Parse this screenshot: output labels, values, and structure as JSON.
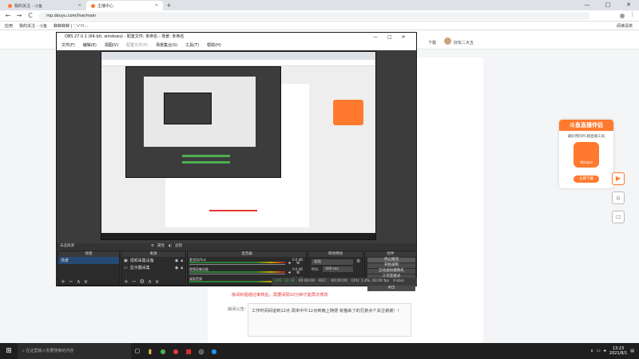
{
  "browser": {
    "tabs": [
      {
        "title": "我的关注 - 斗鱼",
        "active": false
      },
      {
        "title": "主播中心",
        "active": true
      }
    ],
    "new_tab": "+",
    "url": "mp.douyu.com/live/main",
    "bookmarks": [
      "应用",
      "我的关注 - 斗鱼",
      "蝉蝉蝉蝉 | '.'•'ﾂﾂ..."
    ],
    "bookmarks_right": "阅读清单",
    "win_min": "—",
    "win_max": "□",
    "win_close": "✕",
    "nav_back": "←",
    "nav_fwd": "→",
    "nav_reload": "C"
  },
  "page": {
    "header_download": "下载",
    "header_user": "好玩二大五",
    "notice_red": "房间标题通过审核后，需要间隔10分钟才能再次修改",
    "announcement_label": "房间公告：",
    "announcement_text": "工作时间间进到12点 周末中午12点到晚上随便 有猫来了的兄弟点个关注谢谢！！"
  },
  "obs": {
    "title": "OBS 27.0.1 (64-bit, windows) - 配置文件: 未命名 - 场景: 未命名",
    "menu": [
      "文件(F)",
      "编辑(E)",
      "视图(V)",
      "配置文件(P)",
      "场景集合(S)",
      "工具(T)",
      "帮助(H)"
    ],
    "source_bar": {
      "no_source": "未选择源",
      "properties": "属性",
      "filters": "滤镜"
    },
    "scenes": {
      "header": "场景",
      "items": [
        "场景"
      ]
    },
    "sources": {
      "header": "来源",
      "items": [
        "视频采集设备",
        "显示器采集"
      ]
    },
    "mixer": {
      "header": "混音器",
      "channels": [
        {
          "name": "麦克风/Aux",
          "db": "0.0 dB"
        },
        {
          "name": "视频采集设备",
          "db": "0.0 dB"
        },
        {
          "name": "桌面音频",
          "db": "0.0 dB"
        }
      ]
    },
    "transitions": {
      "header": "转场特效",
      "type": "淡化",
      "duration_label": "时长",
      "duration": "300 ms"
    },
    "controls": {
      "header": "控件",
      "buttons": [
        "停止推流",
        "开始录制",
        "启动虚拟摄像机",
        "工作室模式",
        "设置",
        "退出"
      ]
    },
    "status": {
      "live": "LIVE: 12:38",
      "live_time": "00:00:00",
      "rec_label": "REC:",
      "rec_time": "00:00:00",
      "cpu": "CPU: 1.4%, 60.00 fps",
      "kbps": "0 kb/s"
    }
  },
  "ad": {
    "brand": "斗鱼直播伴侣",
    "subtitle": "最好用的PC端直播工具",
    "logo": "douyu",
    "button": "立即下载"
  },
  "side_buttons": [
    "play-icon",
    "home-icon",
    "screen-icon"
  ],
  "taskbar": {
    "search_placeholder": "在这里输入你要搜索的内容",
    "time": "13:23",
    "date": "2021/8/1"
  },
  "colors": {
    "accent": "#ff7a2e",
    "obs_bg": "#3c3c3c",
    "red": "#e53935",
    "live_green": "#4caf50"
  }
}
